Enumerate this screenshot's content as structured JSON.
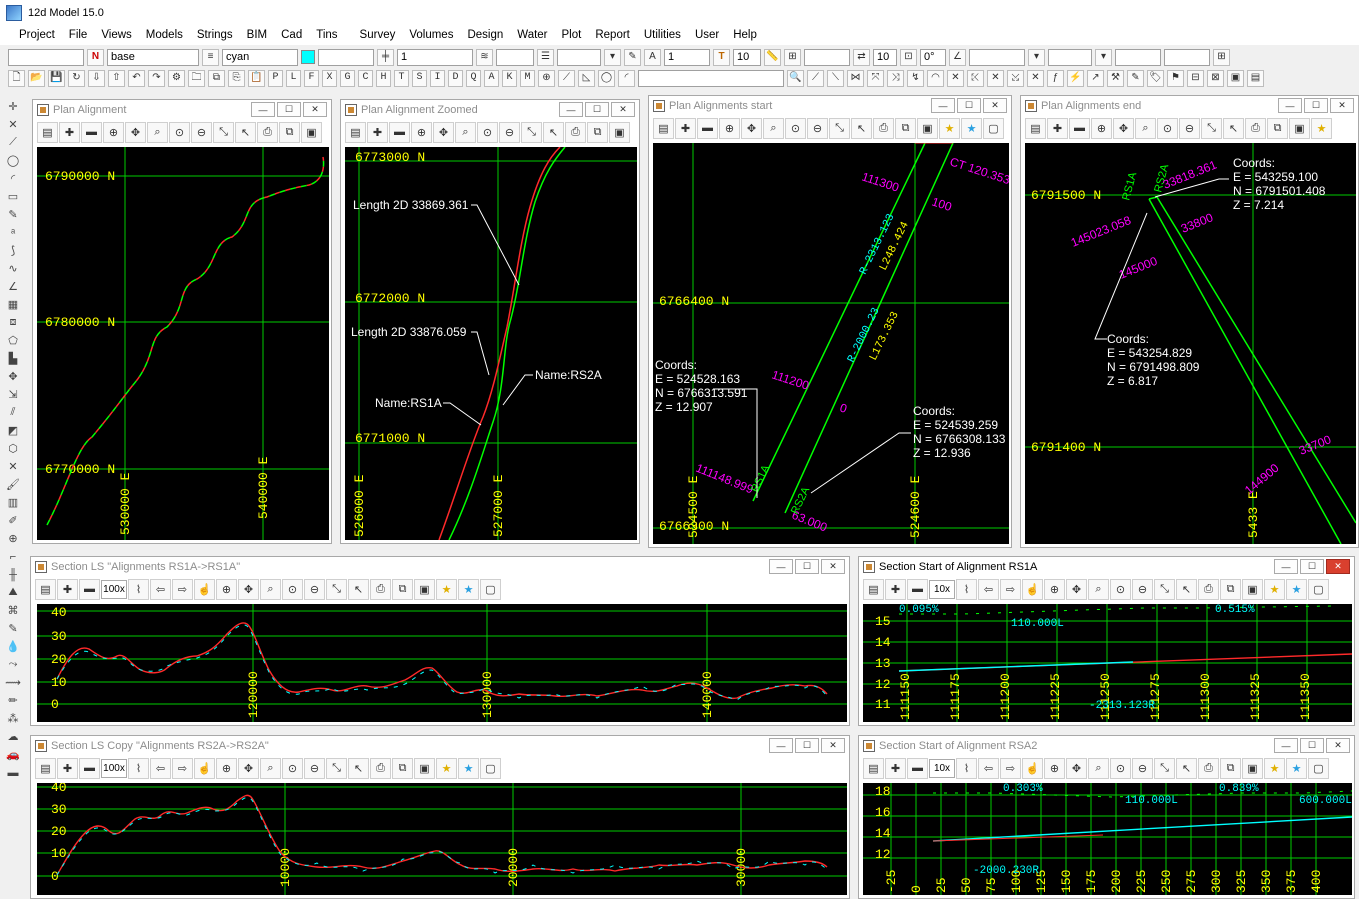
{
  "app": {
    "title": "12d Model  15.0"
  },
  "menu": [
    "Project",
    "File",
    "Views",
    "Models",
    "Strings",
    "BIM",
    "Cad",
    "Tins",
    "Survey",
    "Volumes",
    "Design",
    "Water",
    "Plot",
    "Report",
    "Utilities",
    "User",
    "Help"
  ],
  "toolbar": {
    "model_name": "base",
    "colour_name": "cyan",
    "colour_hex": "#00ffff",
    "field_one": "1",
    "field_ten_a": "10",
    "field_one_b": "1",
    "field_ten_b": "10",
    "field_ten_c": "10",
    "field_angle": "0°",
    "letters": [
      "P",
      "L",
      "F",
      "X",
      "G",
      "C",
      "H",
      "T",
      "S",
      "I",
      "D",
      "Q",
      "A",
      "K",
      "M"
    ]
  },
  "windows": {
    "plan_alignment": {
      "title": "Plan Alignment",
      "y_labels": [
        "6790000 N",
        "6780000 N",
        "6770000 N"
      ],
      "x_labels": [
        "530000 E",
        "540000 E"
      ]
    },
    "plan_zoomed": {
      "title": "Plan Alignment Zoomed",
      "y_labels": [
        "6773000 N",
        "6772000 N",
        "6771000 N"
      ],
      "x_labels": [
        "526000 E",
        "527000 E"
      ],
      "notes": [
        "Length 2D 33869.361",
        "Length 2D 33876.059",
        "Name:RS2A",
        "Name:RS1A"
      ]
    },
    "plan_start": {
      "title": "Plan Alignments start",
      "y_labels": [
        "6766400 N",
        "6766300 N"
      ],
      "x_labels": [
        "524500 E",
        "524600 E"
      ],
      "chainages": [
        "111300",
        "CT 120.353",
        "100",
        "111200",
        "0",
        "111148.999",
        "63.000"
      ],
      "geometry": [
        "R-2313.123",
        "L248.424",
        "R-2000.23",
        "L173.353"
      ],
      "string_names": [
        "RS1A",
        "RS2A"
      ],
      "coords_a": {
        "heading": "Coords:",
        "e": "E = 524528.163",
        "n": "N = 6766313.591",
        "z": "Z = 12.907"
      },
      "coords_b": {
        "heading": "Coords:",
        "e": "E = 524539.259",
        "n": "N = 6766308.133",
        "z": "Z = 12.936"
      }
    },
    "plan_end": {
      "title": "Plan Alignments end",
      "y_labels": [
        "6791500 N",
        "6791400 N"
      ],
      "x_labels": [
        "5433 E"
      ],
      "chainages": [
        "33818.361",
        "145023.058",
        "33800",
        "145000",
        "33700",
        "144900"
      ],
      "string_names": [
        "RS1A",
        "RS2A"
      ],
      "coords_a": {
        "heading": "Coords:",
        "e": "E = 543259.100",
        "n": "N = 6791501.408",
        "z": "Z = 7.214"
      },
      "coords_b": {
        "heading": "Coords:",
        "e": "E = 543254.829",
        "n": "N = 6791498.809",
        "z": "Z = 6.817"
      }
    },
    "section_ls": {
      "title": "Section LS \"Alignments RS1A->RS1A\"",
      "zoom": "100x",
      "y_labels": [
        "40",
        "30",
        "20",
        "10",
        "0"
      ],
      "x_labels": [
        "120000",
        "130000",
        "140000"
      ]
    },
    "section_ls_copy": {
      "title": "Section LS Copy \"Alignments RS2A->RS2A\"",
      "zoom": "100x",
      "y_labels": [
        "40",
        "30",
        "20",
        "10",
        "0"
      ],
      "x_labels": [
        "10000",
        "20000",
        "30000"
      ]
    },
    "section_start_rs1a": {
      "title": "Section Start of Alignment RS1A",
      "zoom": "10x",
      "y_labels": [
        "15",
        "14",
        "13",
        "12",
        "11"
      ],
      "x_labels": [
        "111150",
        "111175",
        "111200",
        "111225",
        "111250",
        "111275",
        "111300",
        "111325",
        "111350"
      ],
      "grades": [
        "0.095%",
        "0.515%"
      ],
      "notes": [
        "110.000L",
        "-2313.123R"
      ]
    },
    "section_start_rsa2": {
      "title": "Section Start of Alignment RSA2",
      "zoom": "10x",
      "y_labels": [
        "18",
        "16",
        "14",
        "12"
      ],
      "x_labels": [
        "-25",
        "0",
        "25",
        "50",
        "75",
        "100",
        "125",
        "150",
        "175",
        "200",
        "225",
        "250",
        "275",
        "300",
        "325",
        "350",
        "375",
        "400"
      ],
      "grades": [
        "0.303%",
        "0.839%"
      ],
      "notes": [
        "110.000L",
        "600.000L",
        "-2000.230R"
      ]
    }
  }
}
